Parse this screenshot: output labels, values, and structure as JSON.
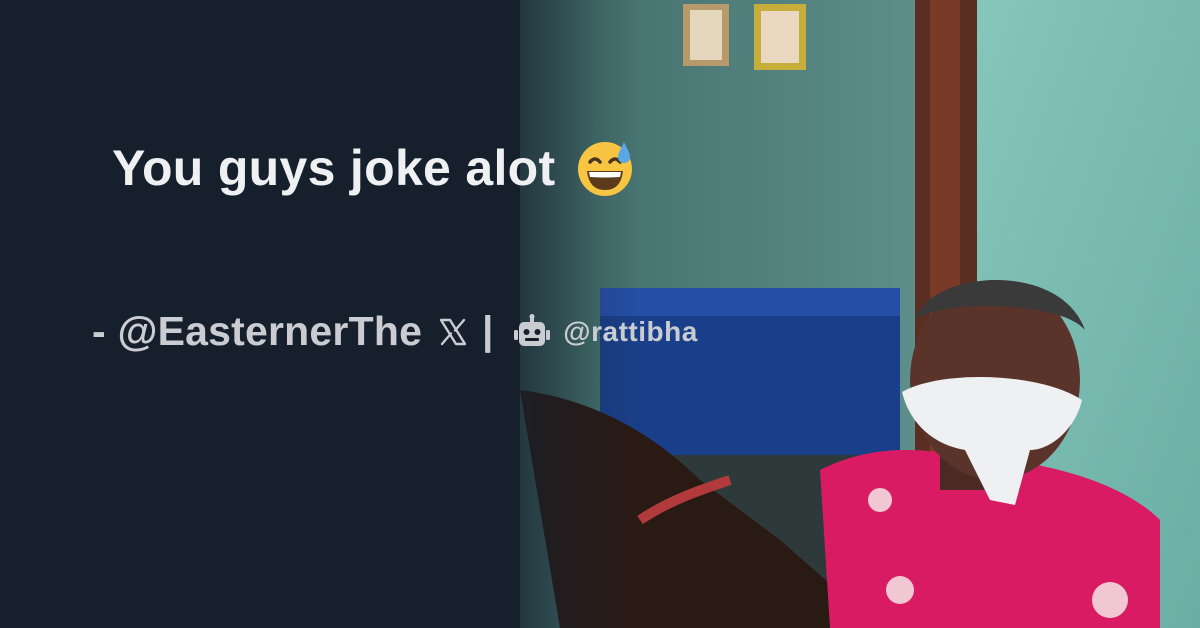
{
  "post": {
    "text": "You guys joke alot",
    "emoji_icon": "grinning-face-with-sweat-icon"
  },
  "credit": {
    "author": "- @EasternerThe",
    "platform_icon": "x-logo-icon",
    "separator": "|",
    "site_icon": "robot-icon",
    "site": "@rattibha"
  },
  "colors": {
    "background": "#16202c",
    "headline_text": "#eef0f2",
    "credit_text": "#c9ccd1"
  }
}
